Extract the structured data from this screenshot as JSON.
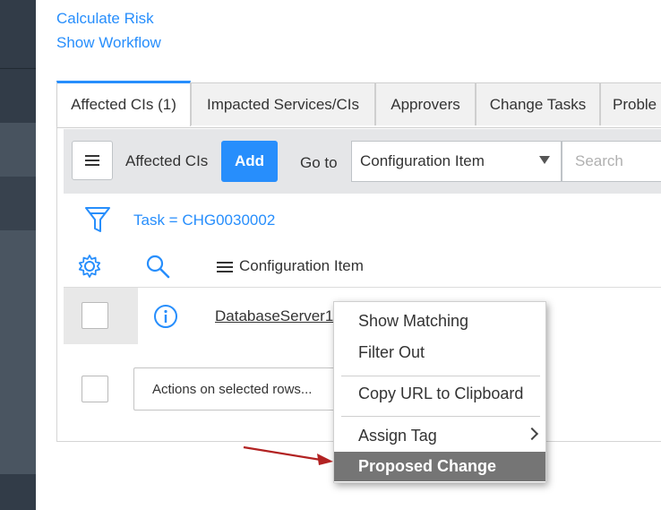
{
  "links": {
    "calculate_risk": "Calculate Risk",
    "show_workflow": "Show Workflow"
  },
  "tabs": [
    {
      "label": "Affected CIs (1)"
    },
    {
      "label": "Impacted Services/CIs"
    },
    {
      "label": "Approvers"
    },
    {
      "label": "Change Tasks"
    },
    {
      "label": "Proble"
    }
  ],
  "toolbar": {
    "list_title": "Affected CIs",
    "add_label": "Add",
    "goto_label": "Go to",
    "goto_selected": "Configuration Item",
    "search_placeholder": "Search"
  },
  "filter": {
    "breadcrumb": "Task = CHG0030002"
  },
  "table": {
    "column_header": "Configuration Item",
    "rows": [
      {
        "ci": "DatabaseServer1"
      }
    ],
    "actions_placeholder": "Actions on selected rows..."
  },
  "context_menu": {
    "items": [
      {
        "label": "Show Matching"
      },
      {
        "label": "Filter Out"
      },
      {
        "label": "Copy URL to Clipboard"
      },
      {
        "label": "Assign Tag"
      },
      {
        "label": "Proposed Change"
      }
    ],
    "highlighted": "Proposed Change"
  },
  "colors": {
    "accent": "#278efc",
    "nav_dark": "#303a46",
    "menu_highlight": "#757575",
    "arrow": "#b22222"
  },
  "icons": [
    "hamburger-icon",
    "filter-funnel-icon",
    "gear-icon",
    "search-icon",
    "info-icon",
    "caret-down-icon",
    "chevron-right-icon",
    "arrow-icon"
  ]
}
